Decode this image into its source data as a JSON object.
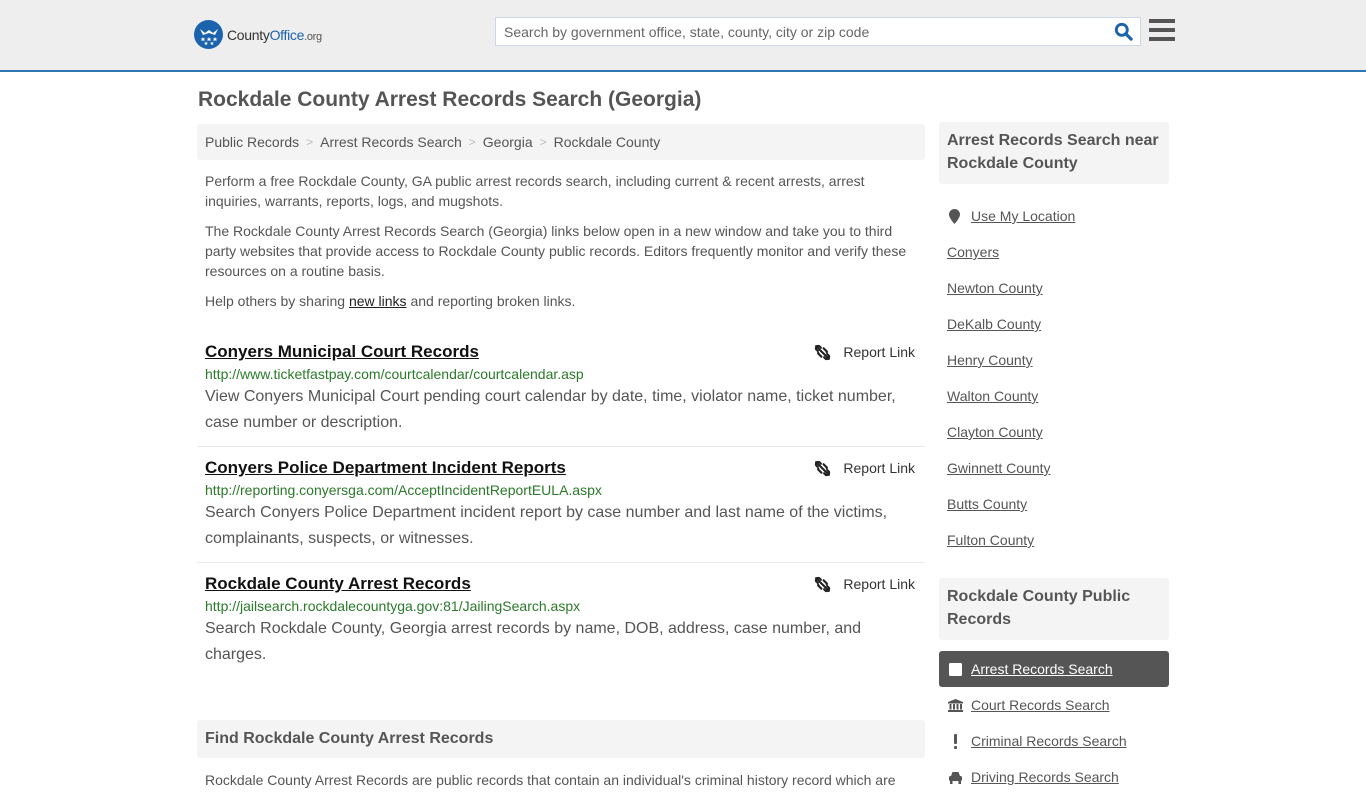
{
  "header": {
    "logo": {
      "name_part1": "County",
      "name_part2": "Office",
      "tld": ".org"
    },
    "search": {
      "placeholder": "Search by government office, state, county, city or zip code",
      "value": ""
    },
    "brand_color": "#1b63ad",
    "accent_line_color": "#2e77b5"
  },
  "page": {
    "title": "Rockdale County Arrest Records Search (Georgia)"
  },
  "breadcrumb": [
    {
      "label": "Public Records"
    },
    {
      "label": "Arrest Records Search"
    },
    {
      "label": "Georgia"
    },
    {
      "label": "Rockdale County"
    }
  ],
  "breadcrumb_separator": ">",
  "intro": {
    "p1": "Perform a free Rockdale County, GA public arrest records search, including current & recent arrests, arrest inquiries, warrants, reports, logs, and mugshots.",
    "p2": "The Rockdale County Arrest Records Search (Georgia) links below open in a new window and take you to third party websites that provide access to Rockdale County public records. Editors frequently monitor and verify these resources on a routine basis.",
    "p3_before": "Help others by sharing ",
    "p3_link": "new links",
    "p3_after": " and reporting broken links."
  },
  "results": [
    {
      "title": "Conyers Municipal Court Records",
      "url": "http://www.ticketfastpay.com/courtcalendar/courtcalendar.asp",
      "description": "View Conyers Municipal Court pending court calendar by date, time, violator name, ticket number, case number or description.",
      "report_label": "Report Link"
    },
    {
      "title": "Conyers Police Department Incident Reports",
      "url": "http://reporting.conyersga.com/AcceptIncidentReportEULA.aspx",
      "description": "Search Conyers Police Department incident report by case number and last name of the victims, complainants, suspects, or witnesses.",
      "report_label": "Report Link"
    },
    {
      "title": "Rockdale County Arrest Records",
      "url": "http://jailsearch.rockdalecountyga.gov:81/JailingSearch.aspx",
      "description": "Search Rockdale County, Georgia arrest records by name, DOB, address, case number, and charges.",
      "report_label": "Report Link"
    }
  ],
  "find_section": {
    "heading": "Find Rockdale County Arrest Records",
    "text": "Rockdale County Arrest Records are public records that contain an individual's criminal history record which are"
  },
  "sidebar": {
    "near_heading": "Arrest Records Search near Rockdale County",
    "use_location": "Use My Location",
    "near_items": [
      "Conyers",
      "Newton County",
      "DeKalb County",
      "Henry County",
      "Walton County",
      "Clayton County",
      "Gwinnett County",
      "Butts County",
      "Fulton County"
    ],
    "public_records_heading": "Rockdale County Public Records",
    "public_records_items": [
      {
        "label": "Arrest Records Search",
        "icon": "square-icon",
        "active": true
      },
      {
        "label": "Court Records Search",
        "icon": "courthouse-icon",
        "active": false
      },
      {
        "label": "Criminal Records Search",
        "icon": "exclamation-icon",
        "active": false
      },
      {
        "label": "Driving Records Search",
        "icon": "car-icon",
        "active": false
      }
    ]
  }
}
